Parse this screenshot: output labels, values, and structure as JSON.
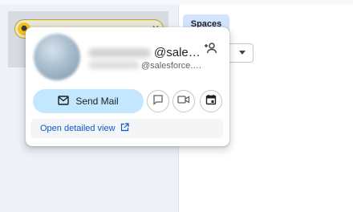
{
  "header": {
    "spaces_tab": "Spaces"
  },
  "chip": {
    "close_glyph": "✕"
  },
  "profile": {
    "email_main": "@sales…",
    "email_sub": "@salesforce.…"
  },
  "actions": {
    "send_mail_label": "Send Mail"
  },
  "footer": {
    "open_detailed_view": "Open detailed view"
  },
  "colors": {
    "accent_blue": "#0b57d0",
    "send_mail_bg": "#c2e7ff",
    "spaces_tab_bg": "#d3e3fd",
    "chip_border": "#c5a700"
  },
  "icons": [
    "chip-bot-icon",
    "chip-close-icon",
    "add-person-icon",
    "mail-icon",
    "chat-icon",
    "video-icon",
    "calendar-icon",
    "open-external-icon",
    "chevron-down-icon"
  ]
}
